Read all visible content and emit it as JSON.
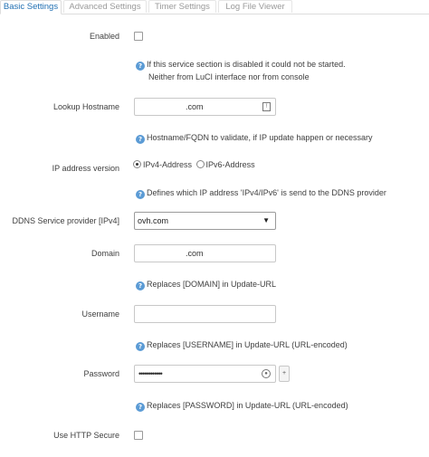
{
  "tabs": [
    {
      "label": "Basic Settings",
      "active": true
    },
    {
      "label": "Advanced Settings",
      "active": false
    },
    {
      "label": "Timer Settings",
      "active": false
    },
    {
      "label": "Log File Viewer",
      "active": false
    }
  ],
  "form": {
    "enabled": {
      "label": "Enabled",
      "checked": false,
      "help_line1": "If this service section is disabled it could not be started.",
      "help_line2": "Neither from LuCI interface nor from console"
    },
    "lookup_hostname": {
      "label": "Lookup Hostname",
      "value": ".com",
      "help": "Hostname/FQDN to validate, if IP update happen or necessary"
    },
    "ip_version": {
      "label": "IP address version",
      "option_ipv4": "IPv4-Address",
      "option_ipv6": "IPv6-Address",
      "selected": "IPv4-Address",
      "help": "Defines which IP address 'IPv4/IPv6' is send to the DDNS provider"
    },
    "service_provider": {
      "label": "DDNS Service provider [IPv4]",
      "value": "ovh.com"
    },
    "domain": {
      "label": "Domain",
      "value": ".com",
      "help": "Replaces [DOMAIN] in Update-URL"
    },
    "username": {
      "label": "Username",
      "value": "",
      "help": "Replaces [USERNAME] in Update-URL (URL-encoded)"
    },
    "password": {
      "label": "Password",
      "value": "••••••••••••",
      "help": "Replaces [PASSWORD] in Update-URL (URL-encoded)"
    },
    "use_https": {
      "label": "Use HTTP Secure",
      "checked": false
    }
  },
  "icons": {
    "help": "help-icon",
    "reveal": "eye-icon",
    "lookup": "field-picker-icon",
    "add": "plus-icon"
  },
  "colors": {
    "active_tab": "#2170b3",
    "help_icon": "#5b9bd5",
    "text": "#404040"
  }
}
